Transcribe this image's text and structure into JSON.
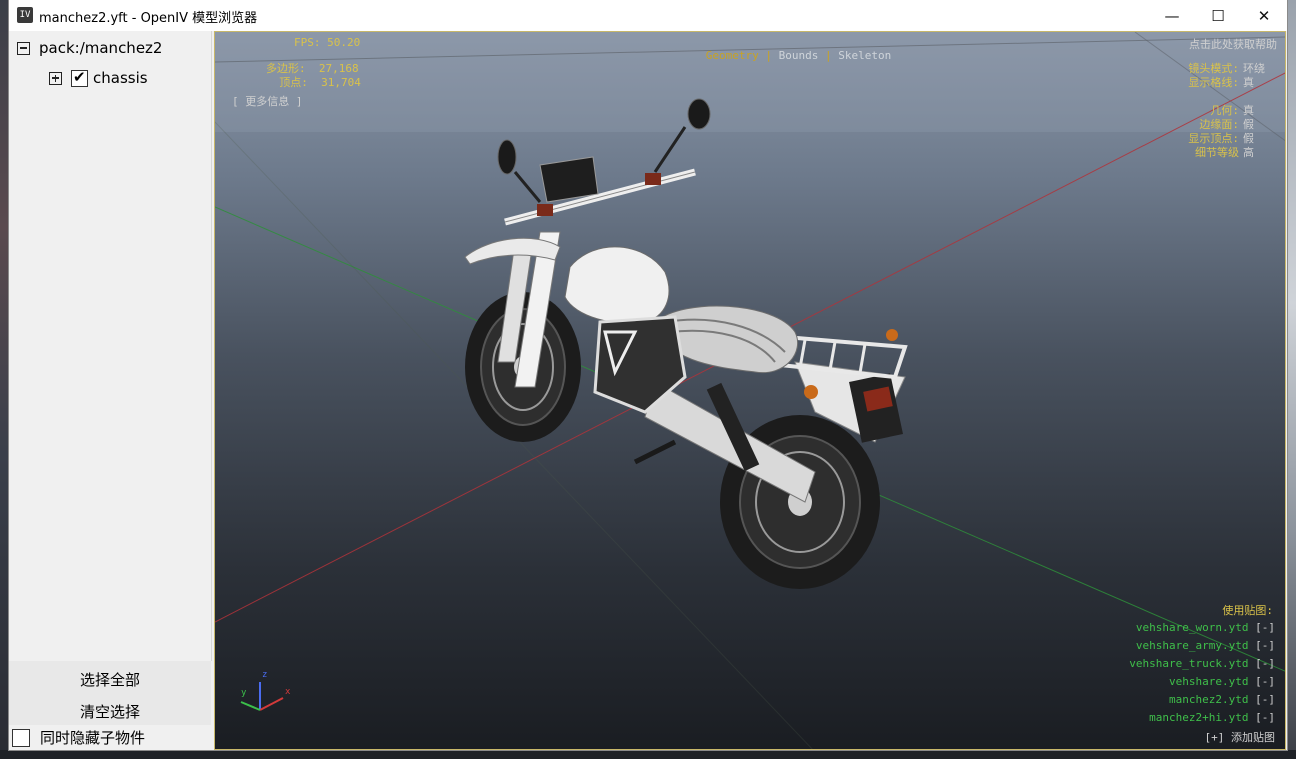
{
  "window": {
    "title": "manchez2.yft - OpenIV 模型浏览器",
    "icon_label": "IV",
    "controls": {
      "minimize": "—",
      "maximize": "☐",
      "close": "✕"
    }
  },
  "tree": {
    "root_label": "pack:/manchez2",
    "child_label": "chassis",
    "child_checked": true
  },
  "buttons": {
    "select_all": "选择全部",
    "clear_selection": "清空选择"
  },
  "hide_children_label": "同时隐藏子物件",
  "hud": {
    "fps": "FPS: 50.20",
    "polygons": "多边形:  27,168",
    "vertices": "  顶点:  31,704",
    "more_info": "[ 更多信息 ]",
    "tabs": {
      "geometry": "Geometry",
      "sep": " | ",
      "bounds": "Bounds",
      "skeleton": "Skeleton"
    },
    "help": "点击此处获取帮助",
    "camera_mode_label": "镜头模式:",
    "camera_mode_value": "环绕",
    "show_grid_label": "显示格线:",
    "show_grid_value": "真",
    "geometry_label": "几何:",
    "geometry_value": "真",
    "edge_faces_label": "边缘面:",
    "edge_faces_value": "假",
    "show_vertices_label": "显示顶点:",
    "show_vertices_value": "假",
    "lod_label": "细节等级",
    "lod_value": "高",
    "textures_title": "使用贴图:",
    "textures": [
      "vehshare_worn.ytd",
      "vehshare_army.ytd",
      "vehshare_truck.ytd",
      "vehshare.ytd",
      "manchez2.ytd",
      "manchez2+hi.ytd"
    ],
    "texture_remove": "[-]",
    "add_texture": "[+] 添加贴图",
    "axis_x": "x",
    "axis_y": "y",
    "axis_z": "z"
  },
  "colors": {
    "hud_yellow": "#d9c24a",
    "hud_green": "#3fbf4a",
    "tab_active": "#c9a322"
  }
}
